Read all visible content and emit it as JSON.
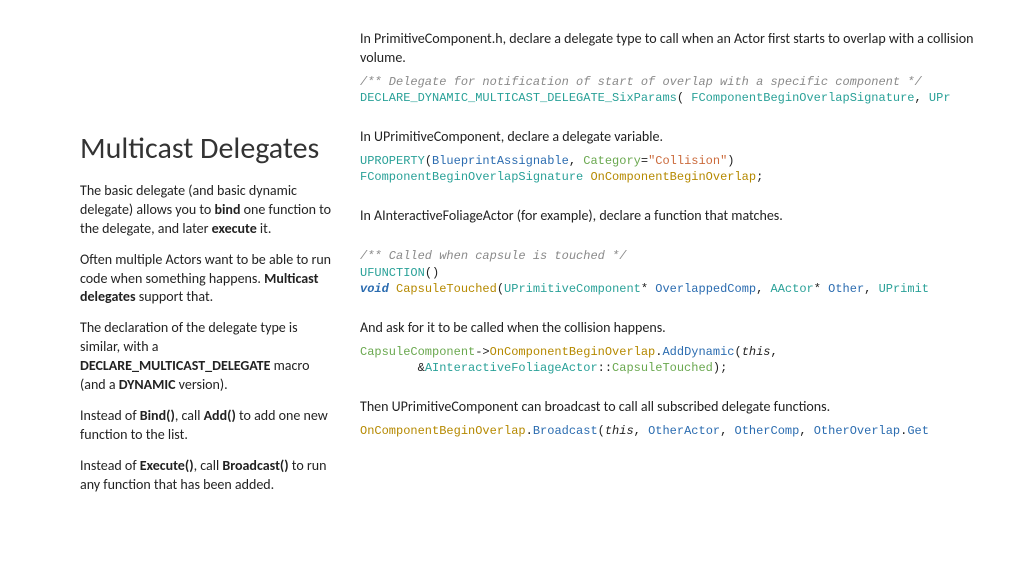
{
  "left": {
    "title": "Multicast Delegates",
    "p1a": "The basic delegate (and basic dynamic delegate) allows you to ",
    "p1b": "bind",
    "p1c": " one function to the delegate, and later ",
    "p1d": "execute",
    "p1e": " it.",
    "p2a": "Often multiple Actors want to be able to run code when something happens. ",
    "p2b": "Multicast delegates",
    "p2c": " support that.",
    "p3a": "The declaration of the delegate type is similar, with a ",
    "p3b": "DECLARE_MULTICAST_DELEGATE",
    "p3c": " macro (and a ",
    "p3d": "DYNAMIC",
    "p3e": " version).",
    "p4a": "Instead of ",
    "p4b": "Bind()",
    "p4c": ", call ",
    "p4d": "Add()",
    "p4e": " to add one new function to the list.",
    "p5a": "Instead of ",
    "p5b": "Execute()",
    "p5c": ", call ",
    "p5d": "Broadcast()",
    "p5e": " to run any function that has been added."
  },
  "right": {
    "r1": "In PrimitiveComponent.h, declare a delegate type to call when an Actor first starts to overlap with a collision volume.",
    "c1_cmt": "/** Delegate for notification of start of overlap with a specific component */",
    "c1_a": "DECLARE_DYNAMIC_MULTICAST_DELEGATE_SixParams",
    "c1_b": "( ",
    "c1_c": "FComponentBeginOverlapSignature",
    "c1_d": ", ",
    "c1_e": "UPr",
    "r2": "In UPrimitiveComponent, declare a delegate variable.",
    "c2_a": "UPROPERTY",
    "c2_b": "(",
    "c2_c": "BlueprintAssignable",
    "c2_d": ", ",
    "c2_e": "Category",
    "c2_f": "=",
    "c2_g": "\"Collision\"",
    "c2_h": ")",
    "c2_i": "FComponentBeginOverlapSignature",
    "c2_j": " ",
    "c2_k": "OnComponentBeginOverlap",
    "c2_l": ";",
    "r3": "In AInteractiveFoliageActor (for example), declare a function that matches.",
    "c3_cmt": "/** Called when capsule is touched */",
    "c3_a": "UFUNCTION",
    "c3_b": "()",
    "c3_c": "void",
    "c3_d": " ",
    "c3_e": "CapsuleTouched",
    "c3_f": "(",
    "c3_g": "UPrimitiveComponent",
    "c3_h": "* ",
    "c3_i": "OverlappedComp",
    "c3_j": ", ",
    "c3_k": "AActor",
    "c3_l": "* ",
    "c3_m": "Other",
    "c3_n": ", ",
    "c3_o": "UPrimit",
    "r4": "And ask for it to be called when the collision happens.",
    "c4_a": "CapsuleComponent",
    "c4_b": "->",
    "c4_c": "OnComponentBeginOverlap",
    "c4_d": ".",
    "c4_e": "AddDynamic",
    "c4_f": "(",
    "c4_g": "this",
    "c4_h": ",",
    "c4_i": "        &",
    "c4_j": "AInteractiveFoliageActor",
    "c4_k": "::",
    "c4_l": "CapsuleTouched",
    "c4_m": ");",
    "r5": "Then UPrimitiveComponent can broadcast to call all subscribed delegate functions.",
    "c5_a": "OnComponentBeginOverlap",
    "c5_b": ".",
    "c5_c": "Broadcast",
    "c5_d": "(",
    "c5_e": "this",
    "c5_f": ", ",
    "c5_g": "OtherActor",
    "c5_h": ", ",
    "c5_i": "OtherComp",
    "c5_j": ", ",
    "c5_k": "OtherOverlap",
    "c5_l": ".",
    "c5_m": "Get"
  }
}
